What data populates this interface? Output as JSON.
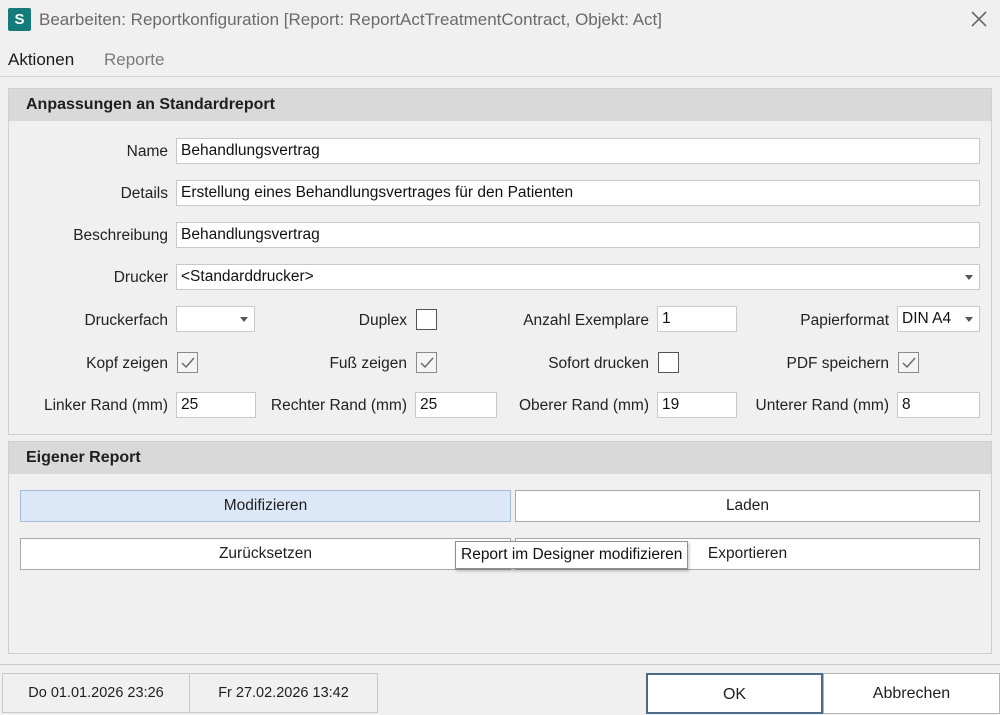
{
  "window": {
    "title": "Bearbeiten: Reportkonfiguration [Report: ReportActTreatmentContract, Objekt: Act]",
    "app_icon_letter": "S"
  },
  "menu": {
    "items": [
      "Aktionen",
      "Reporte"
    ]
  },
  "section1": {
    "header": "Anpassungen an Standardreport",
    "name": {
      "label": "Name",
      "value": "Behandlungsvertrag"
    },
    "details": {
      "label": "Details",
      "value": "Erstellung eines Behandlungsvertrages für den Patienten"
    },
    "beschreibung": {
      "label": "Beschreibung",
      "value": "Behandlungsvertrag"
    },
    "drucker": {
      "label": "Drucker",
      "value": "<Standarddrucker>"
    },
    "druckerfach": {
      "label": "Druckerfach",
      "value": ""
    },
    "duplex": {
      "label": "Duplex",
      "checked": false
    },
    "anzahl": {
      "label": "Anzahl Exemplare",
      "value": "1"
    },
    "papierformat": {
      "label": "Papierformat",
      "value": "DIN A4"
    },
    "kopf": {
      "label": "Kopf zeigen",
      "checked": true
    },
    "fuss": {
      "label": "Fuß zeigen",
      "checked": true
    },
    "sofort": {
      "label": "Sofort drucken",
      "checked": false
    },
    "pdf": {
      "label": "PDF speichern",
      "checked": true
    },
    "linker": {
      "label": "Linker Rand (mm)",
      "value": "25"
    },
    "rechter": {
      "label": "Rechter Rand (mm)",
      "value": "25"
    },
    "oberer": {
      "label": "Oberer Rand (mm)",
      "value": "19"
    },
    "unterer": {
      "label": "Unterer Rand (mm)",
      "value": "8"
    }
  },
  "section2": {
    "header": "Eigener Report",
    "buttons": {
      "modifizieren": "Modifizieren",
      "laden": "Laden",
      "zuruecksetzen": "Zurücksetzen",
      "exportieren": "Exportieren"
    },
    "tooltip": "Report im Designer modifizieren"
  },
  "status": {
    "created": "Do 01.01.2026 23:26",
    "modified": "Fr 27.02.2026 13:42"
  },
  "dialog": {
    "ok": "OK",
    "cancel": "Abbrechen"
  },
  "colors": {
    "accent": "#157a7a",
    "active_button": "#dce8f8",
    "ok_border": "#4a6a8a"
  }
}
